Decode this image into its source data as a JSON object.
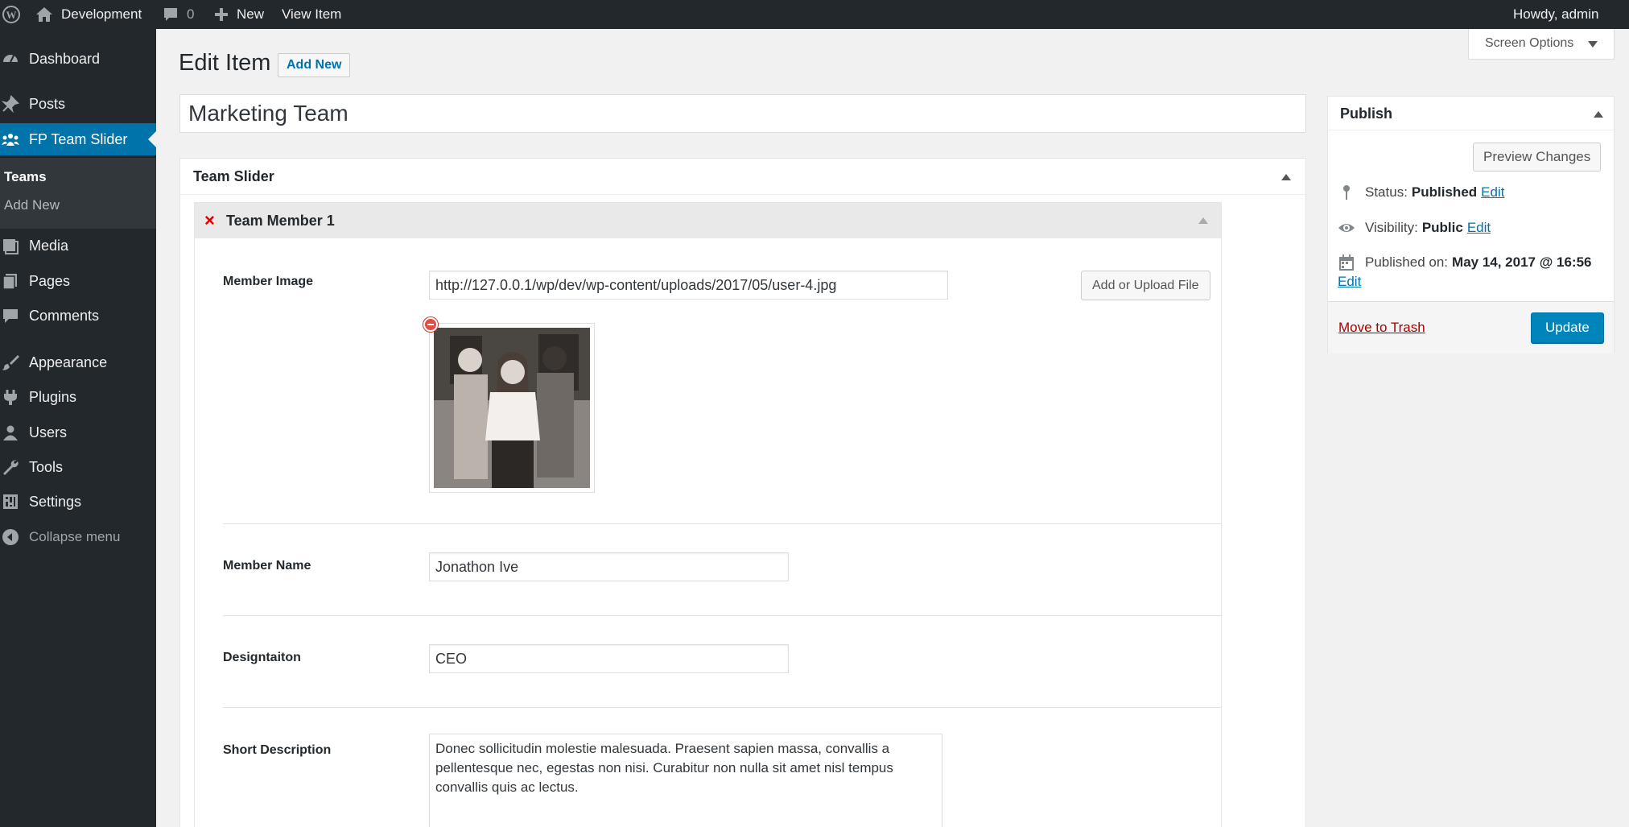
{
  "admin_bar": {
    "site_name": "Development",
    "comments_count": "0",
    "new_label": "New",
    "view_item_label": "View Item",
    "greeting": "Howdy, admin",
    "icons": [
      "wordpress-icon",
      "home-icon",
      "comment-icon",
      "plus-icon"
    ]
  },
  "sidebar": {
    "items": [
      {
        "label": "Dashboard",
        "icon": "dashboard-icon"
      },
      {
        "label": "Posts",
        "icon": "pin-icon"
      },
      {
        "label": "FP Team Slider",
        "icon": "groups-icon",
        "current": true
      },
      {
        "label": "Media",
        "icon": "media-icon"
      },
      {
        "label": "Pages",
        "icon": "pages-icon"
      },
      {
        "label": "Comments",
        "icon": "comments-icon"
      },
      {
        "label": "Appearance",
        "icon": "brush-icon"
      },
      {
        "label": "Plugins",
        "icon": "plugin-icon"
      },
      {
        "label": "Users",
        "icon": "users-icon"
      },
      {
        "label": "Tools",
        "icon": "wrench-icon"
      },
      {
        "label": "Settings",
        "icon": "settings-icon"
      }
    ],
    "submenu": [
      {
        "label": "Teams",
        "active": true
      },
      {
        "label": "Add New"
      }
    ],
    "collapse_label": "Collapse menu"
  },
  "header": {
    "title": "Edit Item",
    "add_new_label": "Add New",
    "screen_options_label": "Screen Options"
  },
  "post": {
    "title": "Marketing Team"
  },
  "team_slider": {
    "box_title": "Team Slider",
    "member": {
      "title": "Team Member 1",
      "image_label": "Member Image",
      "image_url": "http://127.0.0.1/wp/dev/wp-content/uploads/2017/05/user-4.jpg",
      "upload_label": "Add or Upload File",
      "name_label": "Member Name",
      "name_value": "Jonathon Ive",
      "designation_label": "Designtaiton",
      "designation_value": "CEO",
      "description_label": "Short Description",
      "description_value": "Donec sollicitudin molestie malesuada. Praesent sapien massa, convallis a pellentesque nec, egestas non nisi. Curabitur non nulla sit amet nisl tempus convallis quis ac lectus."
    }
  },
  "publish": {
    "title": "Publish",
    "preview_label": "Preview Changes",
    "status_label": "Status:",
    "status_value": "Published",
    "visibility_label": "Visibility:",
    "visibility_value": "Public",
    "published_label": "Published on:",
    "published_value": "May 14, 2017 @ 16:56",
    "edit_label": "Edit",
    "trash_label": "Move to Trash",
    "update_label": "Update"
  },
  "colors": {
    "admin_dark": "#23282d",
    "accent_blue": "#0073aa",
    "primary_button": "#0085ba",
    "trash_red": "#a00"
  }
}
